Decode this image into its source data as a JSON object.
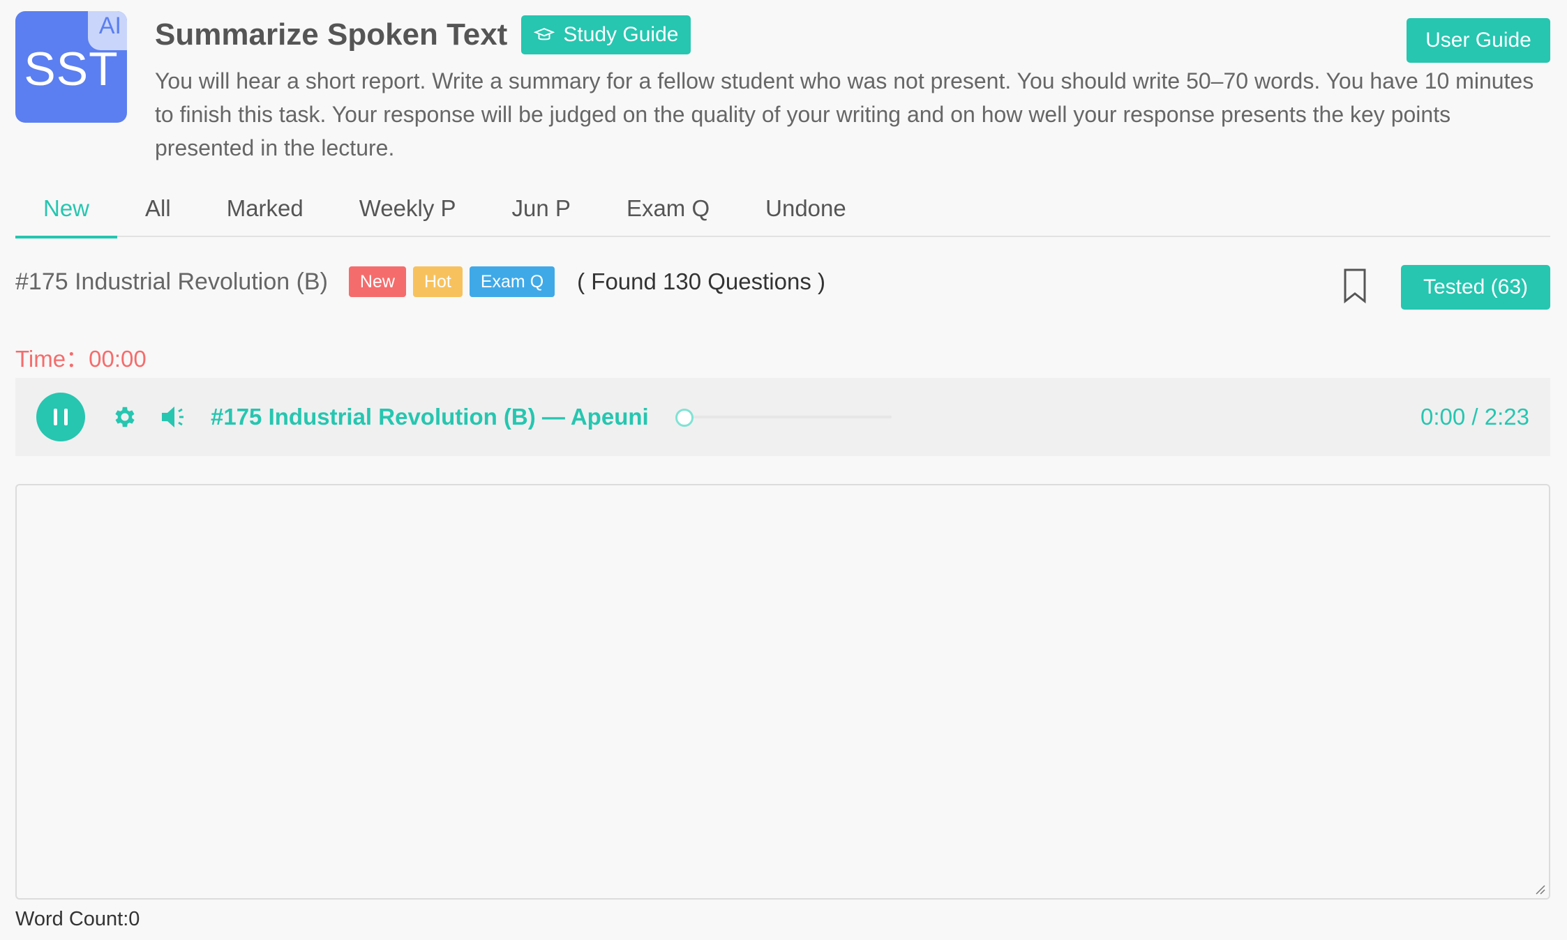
{
  "header": {
    "logo_text": "SST",
    "logo_badge": "AI",
    "title": "Summarize Spoken Text",
    "study_guide_label": "Study Guide",
    "user_guide_label": "User Guide",
    "instructions": "You will hear a short report. Write a summary for a fellow student who was not present. You should write 50–70 words. You have 10 minutes to finish this task. Your response will be judged on the quality of your writing and on how well your response presents the key points presented in the lecture."
  },
  "tabs": [
    {
      "label": "New",
      "active": true
    },
    {
      "label": "All"
    },
    {
      "label": "Marked"
    },
    {
      "label": "Weekly P"
    },
    {
      "label": "Jun P"
    },
    {
      "label": "Exam Q"
    },
    {
      "label": "Undone"
    }
  ],
  "question": {
    "title": "#175 Industrial Revolution (B)",
    "badges": {
      "new": "New",
      "hot": "Hot",
      "exam": "Exam Q"
    },
    "found_text": "( Found 130 Questions )",
    "tested_label": "Tested (63)"
  },
  "timer": {
    "label": "Time：",
    "value": "00:00"
  },
  "player": {
    "track_title": "#175 Industrial Revolution (B) — Apeuni",
    "time_readout": "0:00 / 2:23",
    "progress": 0
  },
  "answer": {
    "value": "",
    "word_count_label": "Word Count:0"
  },
  "icons": {
    "study_guide": "graduation-cap-icon",
    "bookmark": "bookmark-icon",
    "pause": "pause-icon",
    "settings": "gear-icon",
    "volume": "speaker-icon"
  },
  "colors": {
    "accent": "#26c6b0",
    "danger": "#f56c6c",
    "warning": "#f7c25d",
    "info": "#3fa9e8",
    "logo": "#5b7ff0"
  }
}
